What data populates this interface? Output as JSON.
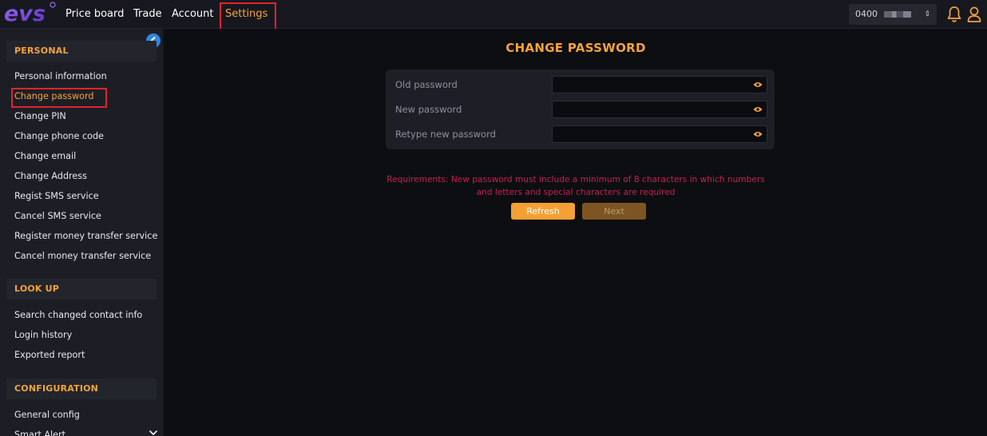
{
  "header": {
    "logo_text": "evs",
    "nav": [
      {
        "label": "Price board"
      },
      {
        "label": "Trade"
      },
      {
        "label": "Account"
      },
      {
        "label": "Settings"
      }
    ],
    "account_prefix": "0400",
    "colors": {
      "accent": "#f6a33a",
      "highlight": "#e0242e",
      "brand": "#7a4ce0"
    }
  },
  "sidebar": {
    "sections": [
      {
        "title": "PERSONAL",
        "items": [
          {
            "label": "Personal information"
          },
          {
            "label": "Change password"
          },
          {
            "label": "Change PIN"
          },
          {
            "label": "Change phone code"
          },
          {
            "label": "Change email"
          },
          {
            "label": "Change Address"
          },
          {
            "label": "Regist SMS service"
          },
          {
            "label": "Cancel SMS service"
          },
          {
            "label": "Register money transfer service"
          },
          {
            "label": "Cancel money transfer service"
          }
        ]
      },
      {
        "title": "LOOK UP",
        "items": [
          {
            "label": "Search changed contact info"
          },
          {
            "label": "Login history"
          },
          {
            "label": "Exported report"
          }
        ]
      },
      {
        "title": "CONFIGURATION",
        "items": [
          {
            "label": "General config"
          },
          {
            "label": "Smart Alert"
          }
        ]
      }
    ]
  },
  "main": {
    "title": "CHANGE PASSWORD",
    "fields": [
      {
        "label": "Old password",
        "value": ""
      },
      {
        "label": "New password",
        "value": ""
      },
      {
        "label": "Retype new password",
        "value": ""
      }
    ],
    "requirements": "Requirements: New password must include a minimum of 8 characters in which numbers and letters and special characters are required",
    "buttons": {
      "refresh": "Refresh",
      "next": "Next"
    }
  }
}
